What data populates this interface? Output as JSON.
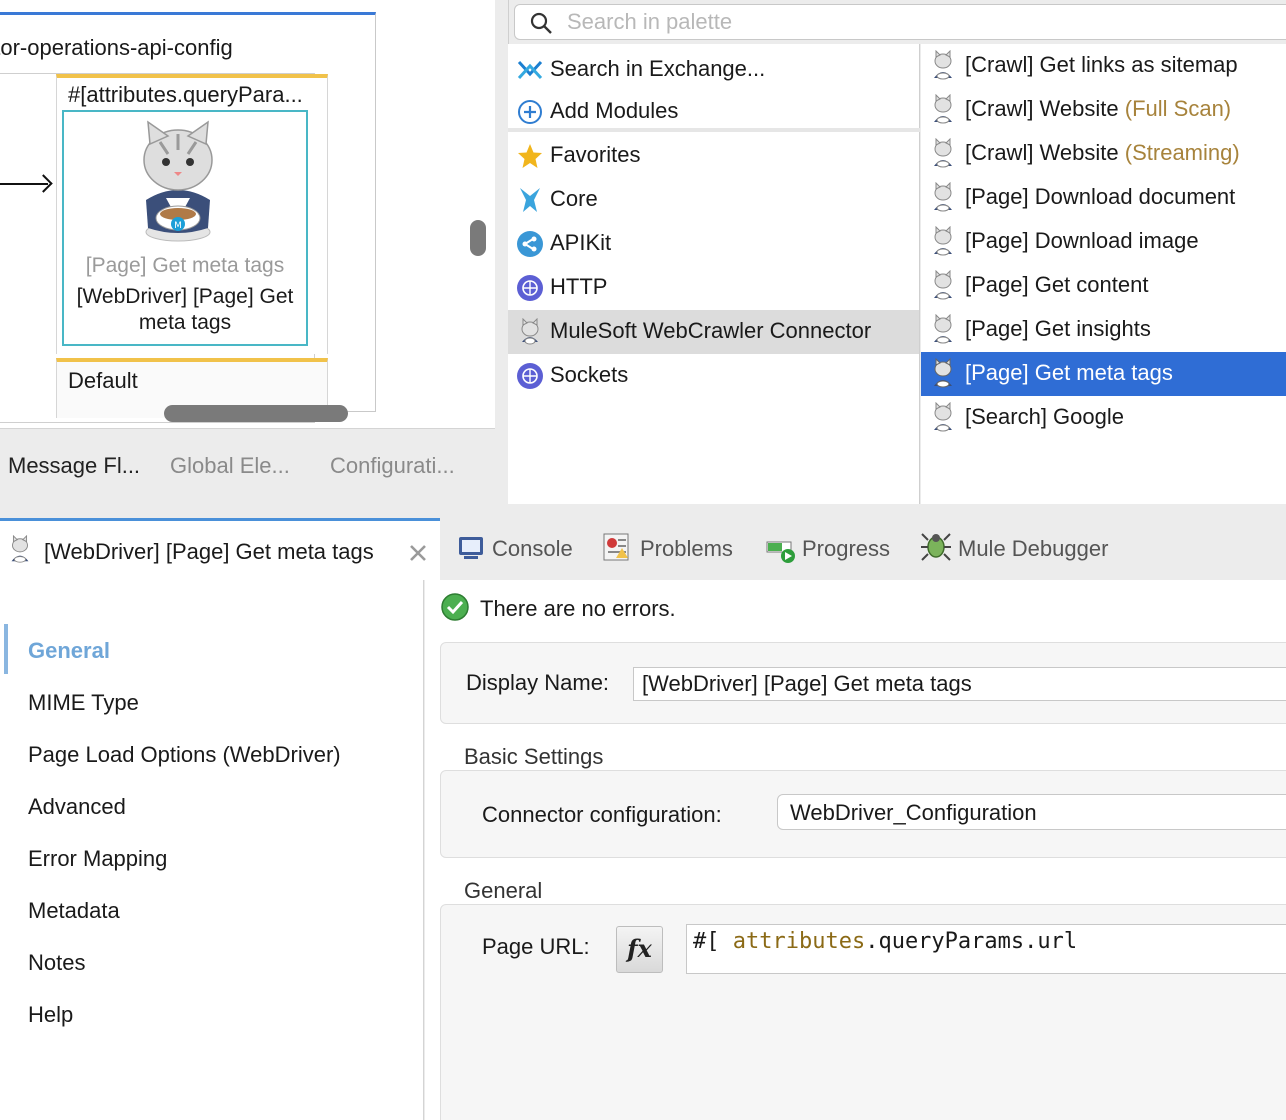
{
  "canvas": {
    "flow_name": "ector-operations-api-config",
    "choice_expression": "#[attributes.queryPara...",
    "component_subtitle": "[Page] Get meta tags",
    "component_label": "[WebDriver] [Page] Get meta tags",
    "default_label": "Default",
    "tabs": [
      "Message Fl...",
      "Global Ele...",
      "Configurati..."
    ]
  },
  "palette": {
    "search_placeholder": "Search in palette",
    "left_items": [
      {
        "label": "Search in Exchange...",
        "icon": "exchange-icon"
      },
      {
        "label": "Add Modules",
        "icon": "plus-circle-icon"
      },
      {
        "label": "Favorites",
        "icon": "star-icon"
      },
      {
        "label": "Core",
        "icon": "mule-core-icon"
      },
      {
        "label": "APIKit",
        "icon": "apikit-icon"
      },
      {
        "label": "HTTP",
        "icon": "globe-icon"
      },
      {
        "label": "MuleSoft WebCrawler Connector",
        "icon": "webcrawler-cat-icon",
        "selected": true
      },
      {
        "label": "Sockets",
        "icon": "globe-icon"
      }
    ],
    "operations": [
      {
        "label": "[Crawl] Get links as sitemap",
        "hint": ""
      },
      {
        "label": "[Crawl] Website",
        "hint": "(Full Scan)"
      },
      {
        "label": "[Crawl] Website",
        "hint": "(Streaming)"
      },
      {
        "label": "[Page] Download document",
        "hint": ""
      },
      {
        "label": "[Page] Download image",
        "hint": ""
      },
      {
        "label": "[Page] Get content",
        "hint": ""
      },
      {
        "label": "[Page] Get insights",
        "hint": ""
      },
      {
        "label": "[Page] Get meta tags",
        "hint": "",
        "selected": true
      },
      {
        "label": "[Search] Google",
        "hint": ""
      }
    ]
  },
  "bottom_tabs": {
    "active": "[WebDriver] [Page] Get meta tags",
    "console": "Console",
    "problems": "Problems",
    "progress": "Progress",
    "debugger": "Mule Debugger"
  },
  "properties": {
    "nav": [
      "General",
      "MIME Type",
      "Page Load Options (WebDriver)",
      "Advanced",
      "Error Mapping",
      "Metadata",
      "Notes",
      "Help"
    ],
    "status": "There are no errors.",
    "display_name_label": "Display Name:",
    "display_name_value": "[WebDriver] [Page] Get meta tags",
    "basic_settings_title": "Basic Settings",
    "connector_config_label": "Connector configuration:",
    "connector_config_value": "WebDriver_Configuration",
    "general_title": "General",
    "page_url_label": "Page URL:",
    "page_url_prefix": "#[",
    "page_url_keyword": "attributes",
    "page_url_rest": ".queryParams.url",
    "fx_label": "fx"
  },
  "colors": {
    "selection_blue": "#2f6dd5",
    "flow_accent": "#3a79d6",
    "choice_accent": "#f1c24a",
    "component_border": "#49b7c6",
    "hint_text": "#a7833c"
  }
}
